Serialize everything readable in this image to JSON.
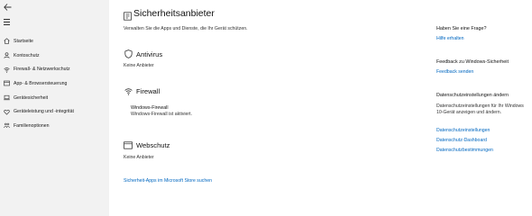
{
  "nav": {
    "items": [
      {
        "icon": "home-icon",
        "label": "Startseite"
      },
      {
        "icon": "person-icon",
        "label": "Kontoschutz"
      },
      {
        "icon": "wifi-icon",
        "label": "Firewall- & Netzwerkschutz"
      },
      {
        "icon": "browser-icon",
        "label": "App- & Browsersteuerung"
      },
      {
        "icon": "laptop-icon",
        "label": "Gerätesicherheit"
      },
      {
        "icon": "heart-icon",
        "label": "Geräteleistung und -integrität"
      },
      {
        "icon": "family-icon",
        "label": "Familienoptionen"
      }
    ]
  },
  "page": {
    "title": "Sicherheitsanbieter",
    "subtitle": "Verwalten Sie die Apps und Dienste, die Ihr Gerät schützen."
  },
  "sections": {
    "antivirus": {
      "title": "Antivirus",
      "status": "Keine Anbieter"
    },
    "firewall": {
      "title": "Firewall",
      "provider_name": "Windows-Firewall",
      "provider_status": "Windows-Firewall ist aktiviert."
    },
    "webschutz": {
      "title": "Webschutz",
      "status": "Keine Anbieter"
    }
  },
  "store_link": "Sicherheit-Apps im Microsoft Store suchen",
  "sidepanel": {
    "question_title": "Haben Sie eine Frage?",
    "question_link": "Hilfe erhalten",
    "feedback_title": "Feedback zu Windows-Sicherheit",
    "feedback_link": "Feedback senden",
    "privacy_title": "Datenschutzeinstellungen ändern",
    "privacy_text": "Datenschutzeinstellungen für Ihr Windows 10-Gerät anzeigen und ändern.",
    "privacy_links": [
      "Datenschutzeinstellungen",
      "Datenschutz-Dashboard",
      "Datenschutzbestimmungen"
    ]
  },
  "colors": {
    "accent": "#0067c0",
    "sidebar": "#f2f2f2"
  }
}
